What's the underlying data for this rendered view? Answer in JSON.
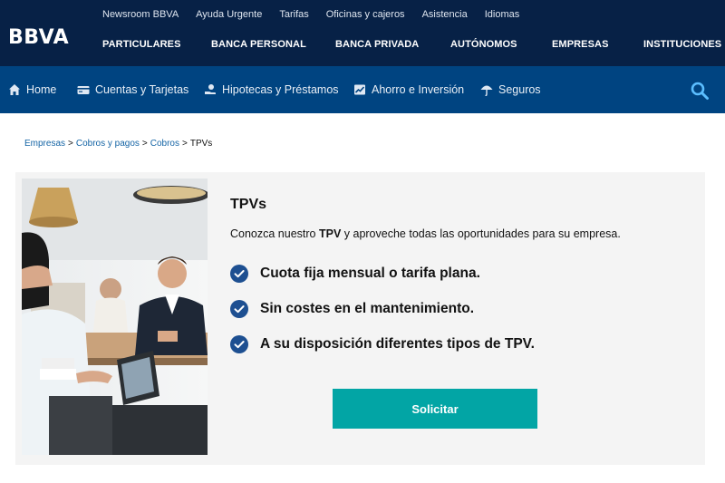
{
  "brand": {
    "logo_text": "BBVA",
    "primary_color": "#072146",
    "secondary_color": "#004481",
    "accent_color": "#02a5a5"
  },
  "utility_nav": [
    "Newsroom BBVA",
    "Ayuda Urgente",
    "Tarifas",
    "Oficinas y cajeros",
    "Asistencia",
    "Idiomas"
  ],
  "main_nav": {
    "particulares": "PARTICULARES",
    "banca_personal": "BANCA PERSONAL",
    "banca_privada": "BANCA PRIVADA",
    "autonomos": "AUTÓNOMOS",
    "empresas": "EMPRESAS",
    "instituciones": "INSTITUCIONES"
  },
  "sub_nav": {
    "home": {
      "label": "Home",
      "icon": "home-icon"
    },
    "cuentas": {
      "label": "Cuentas y Tarjetas",
      "icon": "card-icon"
    },
    "hipotecas": {
      "label": "Hipotecas y Préstamos",
      "icon": "hand-coin-icon"
    },
    "ahorro": {
      "label": "Ahorro e Inversión",
      "icon": "chart-icon"
    },
    "seguros": {
      "label": "Seguros",
      "icon": "umbrella-icon"
    },
    "search_icon": "search-icon"
  },
  "breadcrumb": {
    "item1": "Empresas",
    "item2": "Cobros y pagos",
    "item3": "Cobros",
    "current": "TPVs",
    "separator": ">"
  },
  "card": {
    "title": "TPVs",
    "desc_before": "Conozca nuestro ",
    "desc_bold": "TPV",
    "desc_after": " y aproveche todas las oportunidades para su empresa.",
    "features": [
      "Cuota fija mensual o tarifa plana.",
      "Sin costes en el mantenimiento.",
      "A su disposición diferentes tipos de TPV."
    ],
    "cta_label": "Solicitar"
  }
}
